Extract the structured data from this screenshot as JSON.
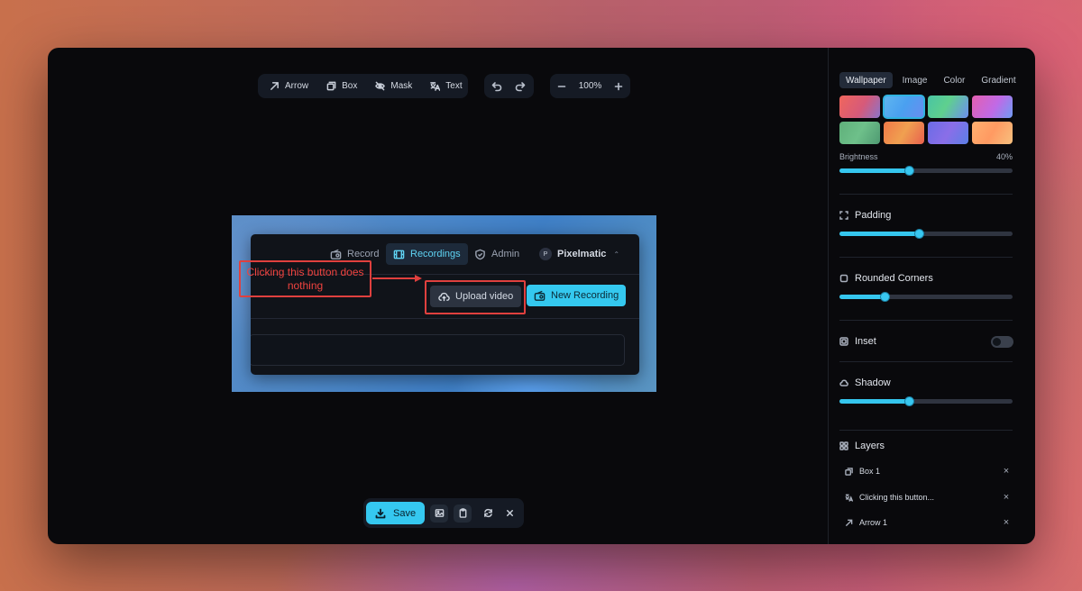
{
  "toolbar": {
    "tools": [
      {
        "label": "Arrow",
        "icon": "arrow-icon"
      },
      {
        "label": "Box",
        "icon": "box-icon"
      },
      {
        "label": "Mask",
        "icon": "mask-icon"
      },
      {
        "label": "Text",
        "icon": "text-icon"
      }
    ],
    "zoom": "100%"
  },
  "preview": {
    "nav": {
      "record": "Record",
      "recordings": "Recordings",
      "admin": "Admin",
      "user_initial": "P",
      "user": "Pixelmatic"
    },
    "upload_label": "Upload video",
    "new_recording_label": "New Recording",
    "annotation_text": "Clicking this button does nothing",
    "annotation_color": "#e0403e"
  },
  "bottom": {
    "save_label": "Save"
  },
  "sidebar": {
    "tabs": [
      "Wallpaper",
      "Image",
      "Color",
      "Gradient"
    ],
    "active_tab": "Wallpaper",
    "swatches": [
      "linear-gradient(120deg,#f0665c,#d65a7a 55%,#8a74c9)",
      "linear-gradient(120deg,#5fb6ef,#4aa0f0 50%,#6a8cf0)",
      "linear-gradient(120deg,#49c4a4,#5fd08e 45%,#6d8ef0)",
      "linear-gradient(120deg,#e35fb0,#c06ae6 55%,#6f9cf5)",
      "linear-gradient(120deg,#5fb07a,#6ec08a 50%,#4f9a72)",
      "linear-gradient(120deg,#f07848,#f0a050 50%,#e8604e)",
      "linear-gradient(120deg,#6a6ce6,#8a6ee8 50%,#5b7fe6)",
      "linear-gradient(120deg,#ffb070,#ff9a62 50%,#f7c07e)"
    ],
    "selected_swatch_index": 1,
    "brightness": {
      "label": "Brightness",
      "value_text": "40%",
      "value": 0.4
    },
    "padding": {
      "label": "Padding",
      "value": 0.46
    },
    "rounded": {
      "label": "Rounded Corners",
      "value": 0.26
    },
    "inset": {
      "label": "Inset",
      "on": false
    },
    "shadow": {
      "label": "Shadow",
      "value": 0.4
    },
    "layers_title": "Layers",
    "layers": [
      {
        "label": "Box 1",
        "icon": "box-icon"
      },
      {
        "label": "Clicking this button...",
        "icon": "text-icon"
      },
      {
        "label": "Arrow 1",
        "icon": "arrow-icon"
      }
    ]
  }
}
